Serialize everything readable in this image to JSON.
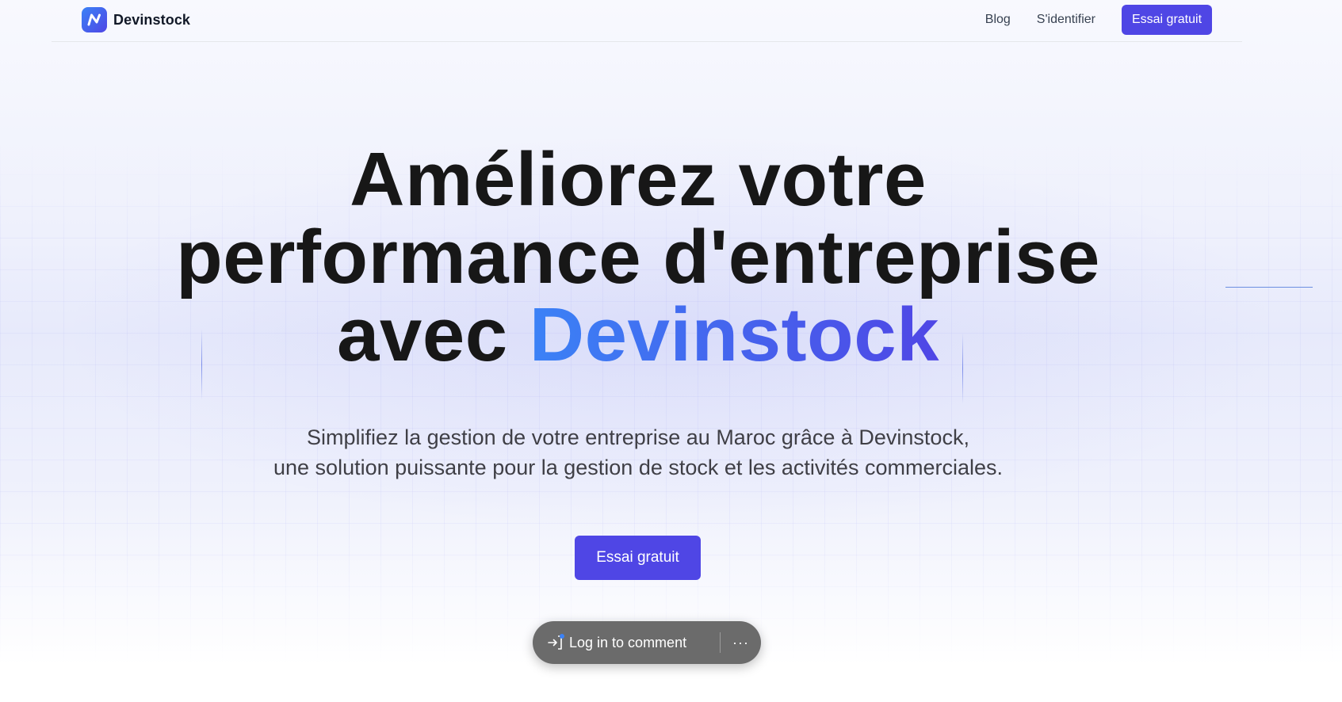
{
  "header": {
    "brand_name": "Devinstock",
    "nav": {
      "blog": "Blog",
      "login": "S'identifier",
      "cta": "Essai gratuit"
    }
  },
  "hero": {
    "title_line1": "Améliorez votre",
    "title_line2": "performance d'entreprise",
    "title_line3_prefix": "avec ",
    "title_highlight": "Devinstock",
    "subtitle_line1": "Simplifiez la gestion de votre entreprise au Maroc grâce à Devinstock,",
    "subtitle_line2": "une solution puissante pour la gestion de stock et les activités commerciales.",
    "cta": "Essai gratuit"
  },
  "comment_bar": {
    "label": "Log in to comment",
    "more": "···"
  },
  "colors": {
    "primary": "#4f46e5",
    "gradient_start": "#3b82f6",
    "gradient_end": "#4f46e5",
    "text": "#171717",
    "comment_bar_bg": "#6b6b6b"
  },
  "icons": {
    "logo": "devinstock-logo-icon",
    "login": "sign-in-icon"
  }
}
